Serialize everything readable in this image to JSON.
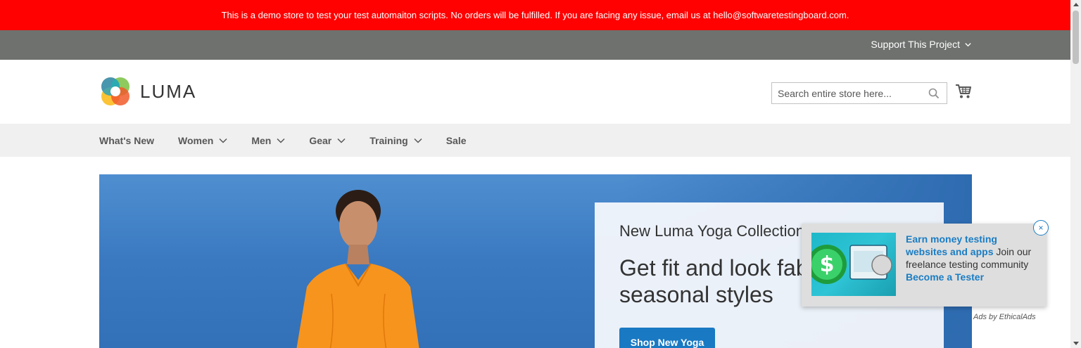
{
  "banner": {
    "text": "This is a demo store to test your test automaiton scripts. No orders will be fulfilled. If you are facing any issue, email us at hello@softwaretestingboard.com."
  },
  "topbar": {
    "support_label": "Support This Project"
  },
  "header": {
    "logo_text": "LUMA",
    "search_placeholder": "Search entire store here..."
  },
  "nav": {
    "items": [
      {
        "label": "What's New"
      },
      {
        "label": "Women"
      },
      {
        "label": "Men"
      },
      {
        "label": "Gear"
      },
      {
        "label": "Training"
      },
      {
        "label": "Sale"
      }
    ]
  },
  "hero": {
    "subtitle": "New Luma Yoga Collection",
    "headline": "Get fit and look fab in new seasonal styles",
    "button_label": "Shop New Yoga"
  },
  "ad": {
    "highlight": "Earn money testing websites and apps",
    "body": " Join our freelance testing community ",
    "cta": "Become a Tester",
    "close_label": "×",
    "credit": "Ads by EthicalAds"
  },
  "colors": {
    "banner_red": "#ff0101",
    "topbar_gray": "#6e716e",
    "nav_bg": "#f0f0f0",
    "button_blue": "#1979c3",
    "ad_link_blue": "#1a7dc4"
  }
}
